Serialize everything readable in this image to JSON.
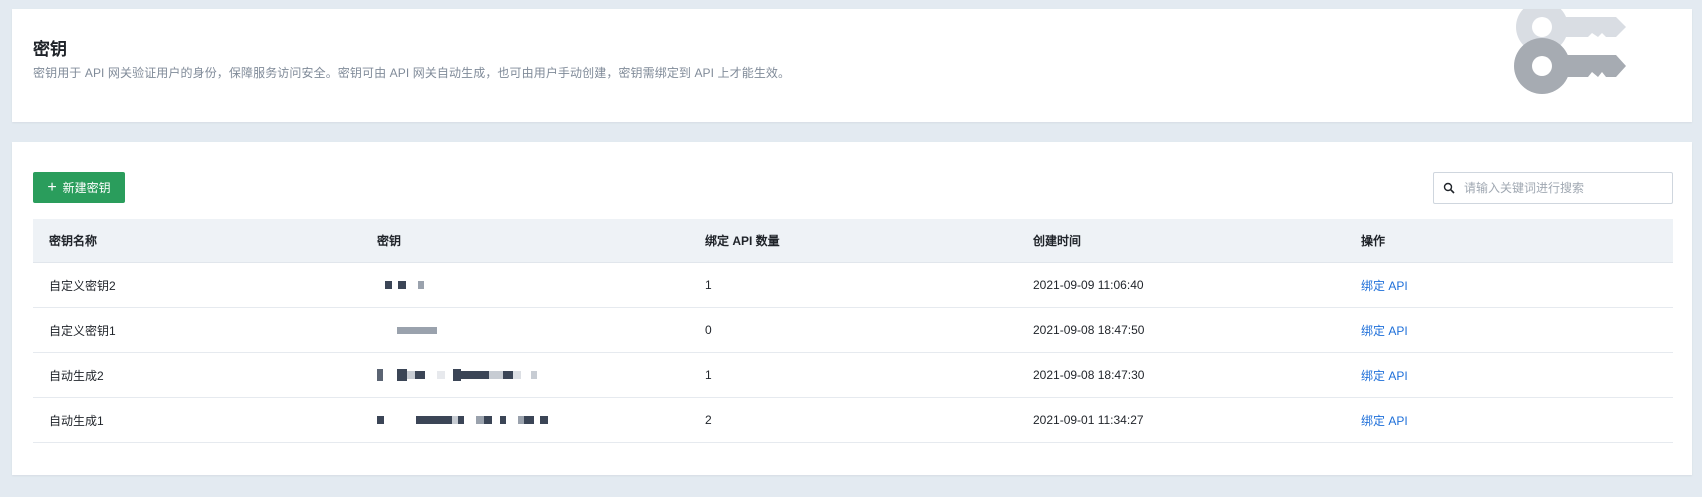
{
  "header": {
    "title": "密钥",
    "description": "密钥用于 API 网关验证用户的身份，保障服务访问安全。密钥可由 API 网关自动生成，也可由用户手动创建，密钥需绑定到 API 上才能生效。",
    "illustration_icon": "key-icon"
  },
  "toolbar": {
    "create_label": "新建密钥",
    "create_icon": "plus-icon",
    "search_placeholder": "请输入关键词进行搜索",
    "search_icon": "search-icon"
  },
  "table": {
    "columns": [
      "密钥名称",
      "密钥",
      "绑定 API 数量",
      "创建时间",
      "操作"
    ],
    "rows": [
      {
        "name": "自定义密钥2",
        "secret_masked": "pixelated",
        "api_count": "1",
        "created": "2021-09-09 11:06:40",
        "action": "绑定 API"
      },
      {
        "name": "自定义密钥1",
        "secret_masked": "pixelated",
        "api_count": "0",
        "created": "2021-09-08 18:47:50",
        "action": "绑定 API"
      },
      {
        "name": "自动生成2",
        "secret_masked": "pixelated",
        "api_count": "1",
        "created": "2021-09-08 18:47:30",
        "action": "绑定 API"
      },
      {
        "name": "自动生成1",
        "secret_masked": "pixelated",
        "api_count": "2",
        "created": "2021-09-01 11:34:27",
        "action": "绑定 API"
      }
    ]
  },
  "colors": {
    "primary_button": "#2a9d5c",
    "link": "#1e6fd9",
    "header_bg": "#eef2f6",
    "page_bg": "#e3eaf1"
  }
}
